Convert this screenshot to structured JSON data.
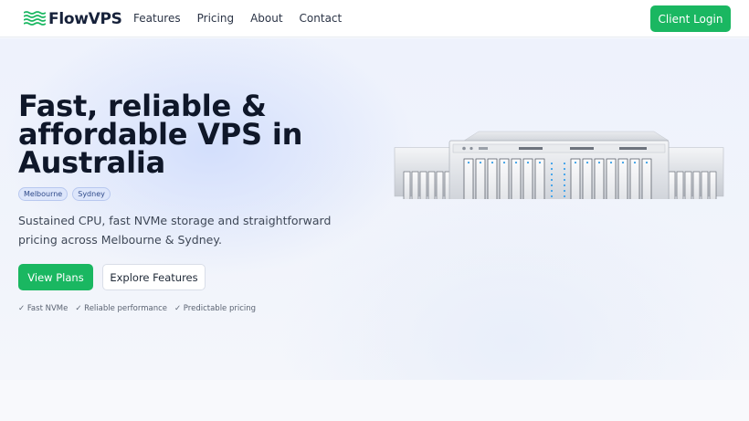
{
  "brand": {
    "name": "FlowVPS",
    "logo_icon": "waves-logo-icon",
    "accent": "#1ab761"
  },
  "nav": {
    "items": [
      {
        "label": "Features"
      },
      {
        "label": "Pricing"
      },
      {
        "label": "About"
      },
      {
        "label": "Contact"
      }
    ]
  },
  "header": {
    "login_label": "Client Login"
  },
  "hero": {
    "title": "Fast, reliable & affordable VPS in Australia",
    "tags": [
      "Melbourne",
      "Sydney"
    ],
    "description": "Sustained CPU, fast NVMe storage and straightforward pricing across Melbourne & Sydney.",
    "primary_cta": "View Plans",
    "secondary_cta": "Explore Features",
    "features": [
      "✓ Fast NVMe",
      "✓ Reliable performance",
      "✓ Predictable pricing"
    ],
    "image": "server-rack-image"
  }
}
